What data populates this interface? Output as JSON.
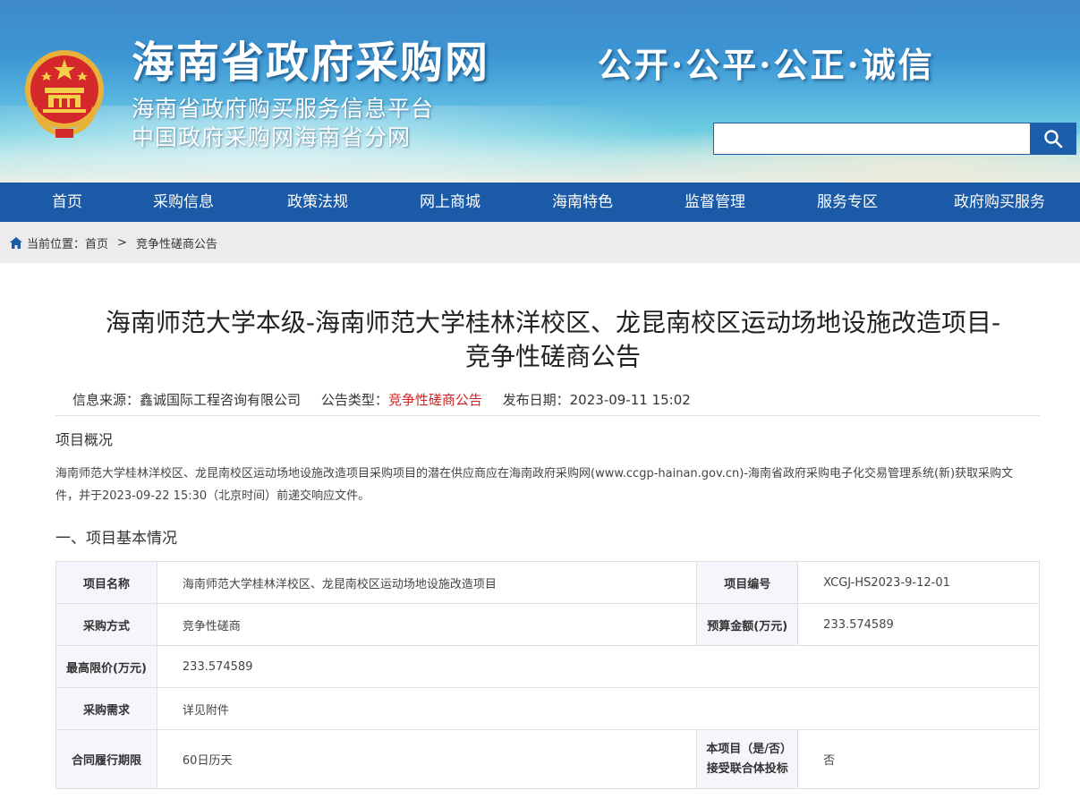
{
  "header": {
    "site_title": "海南省政府采购网",
    "subtitle_1": "海南省政府购买服务信息平台",
    "subtitle_2": "中国政府采购网海南省分网",
    "slogan": "公开·公平·公正·诚信",
    "search": {
      "value": "",
      "placeholder": ""
    }
  },
  "nav": {
    "items": [
      {
        "label": "首页"
      },
      {
        "label": "采购信息"
      },
      {
        "label": "政策法规"
      },
      {
        "label": "网上商城"
      },
      {
        "label": "海南特色"
      },
      {
        "label": "监督管理"
      },
      {
        "label": "服务专区"
      },
      {
        "label": "政府购买服务"
      }
    ]
  },
  "breadcrumb": {
    "prefix": "当前位置：",
    "home": "首页",
    "separator": ">",
    "current": "竞争性磋商公告"
  },
  "article": {
    "title_line1": "海南师范大学本级-海南师范大学桂林洋校区、龙昆南校区运动场地设施改造项目-",
    "title_line2": "竞争性磋商公告",
    "meta": {
      "source_label": "信息来源：",
      "source_value": "鑫诚国际工程咨询有限公司",
      "type_label": "公告类型：",
      "type_value": "竞争性磋商公告",
      "date_label": "发布日期：",
      "date_value": "2023-09-11 15:02"
    },
    "overview_heading": "项目概况",
    "overview_text": "海南师范大学桂林洋校区、龙昆南校区运动场地设施改造项目采购项目的潜在供应商应在海南政府采购网(www.ccgp-hainan.gov.cn)-海南省政府采购电子化交易管理系统(新)获取采购文件，并于2023-09-22 15:30（北京时间）前递交响应文件。",
    "section1_heading": "一、项目基本情况",
    "table": {
      "project_name_label": "项目名称",
      "project_name_value": "海南师范大学桂林洋校区、龙昆南校区运动场地设施改造项目",
      "project_no_label": "项目编号",
      "project_no_value": "XCGJ-HS2023-9-12-01",
      "method_label": "采购方式",
      "method_value": "竞争性磋商",
      "budget_label": "预算金额(万元)",
      "budget_value": "233.574589",
      "max_price_label": "最高限价(万元)",
      "max_price_value": "233.574589",
      "demand_label": "采购需求",
      "demand_value": "详见附件",
      "period_label": "合同履行期限",
      "period_value": "60日历天",
      "consortium_label_1": "本项目（是/否）",
      "consortium_label_2": "接受联合体投标",
      "consortium_value": "否"
    }
  },
  "colors": {
    "nav_bg": "#1b5aa7",
    "breadcrumb_bg": "#ececec",
    "accent_red": "#d32121",
    "table_label_bg": "#f4f6fb"
  }
}
